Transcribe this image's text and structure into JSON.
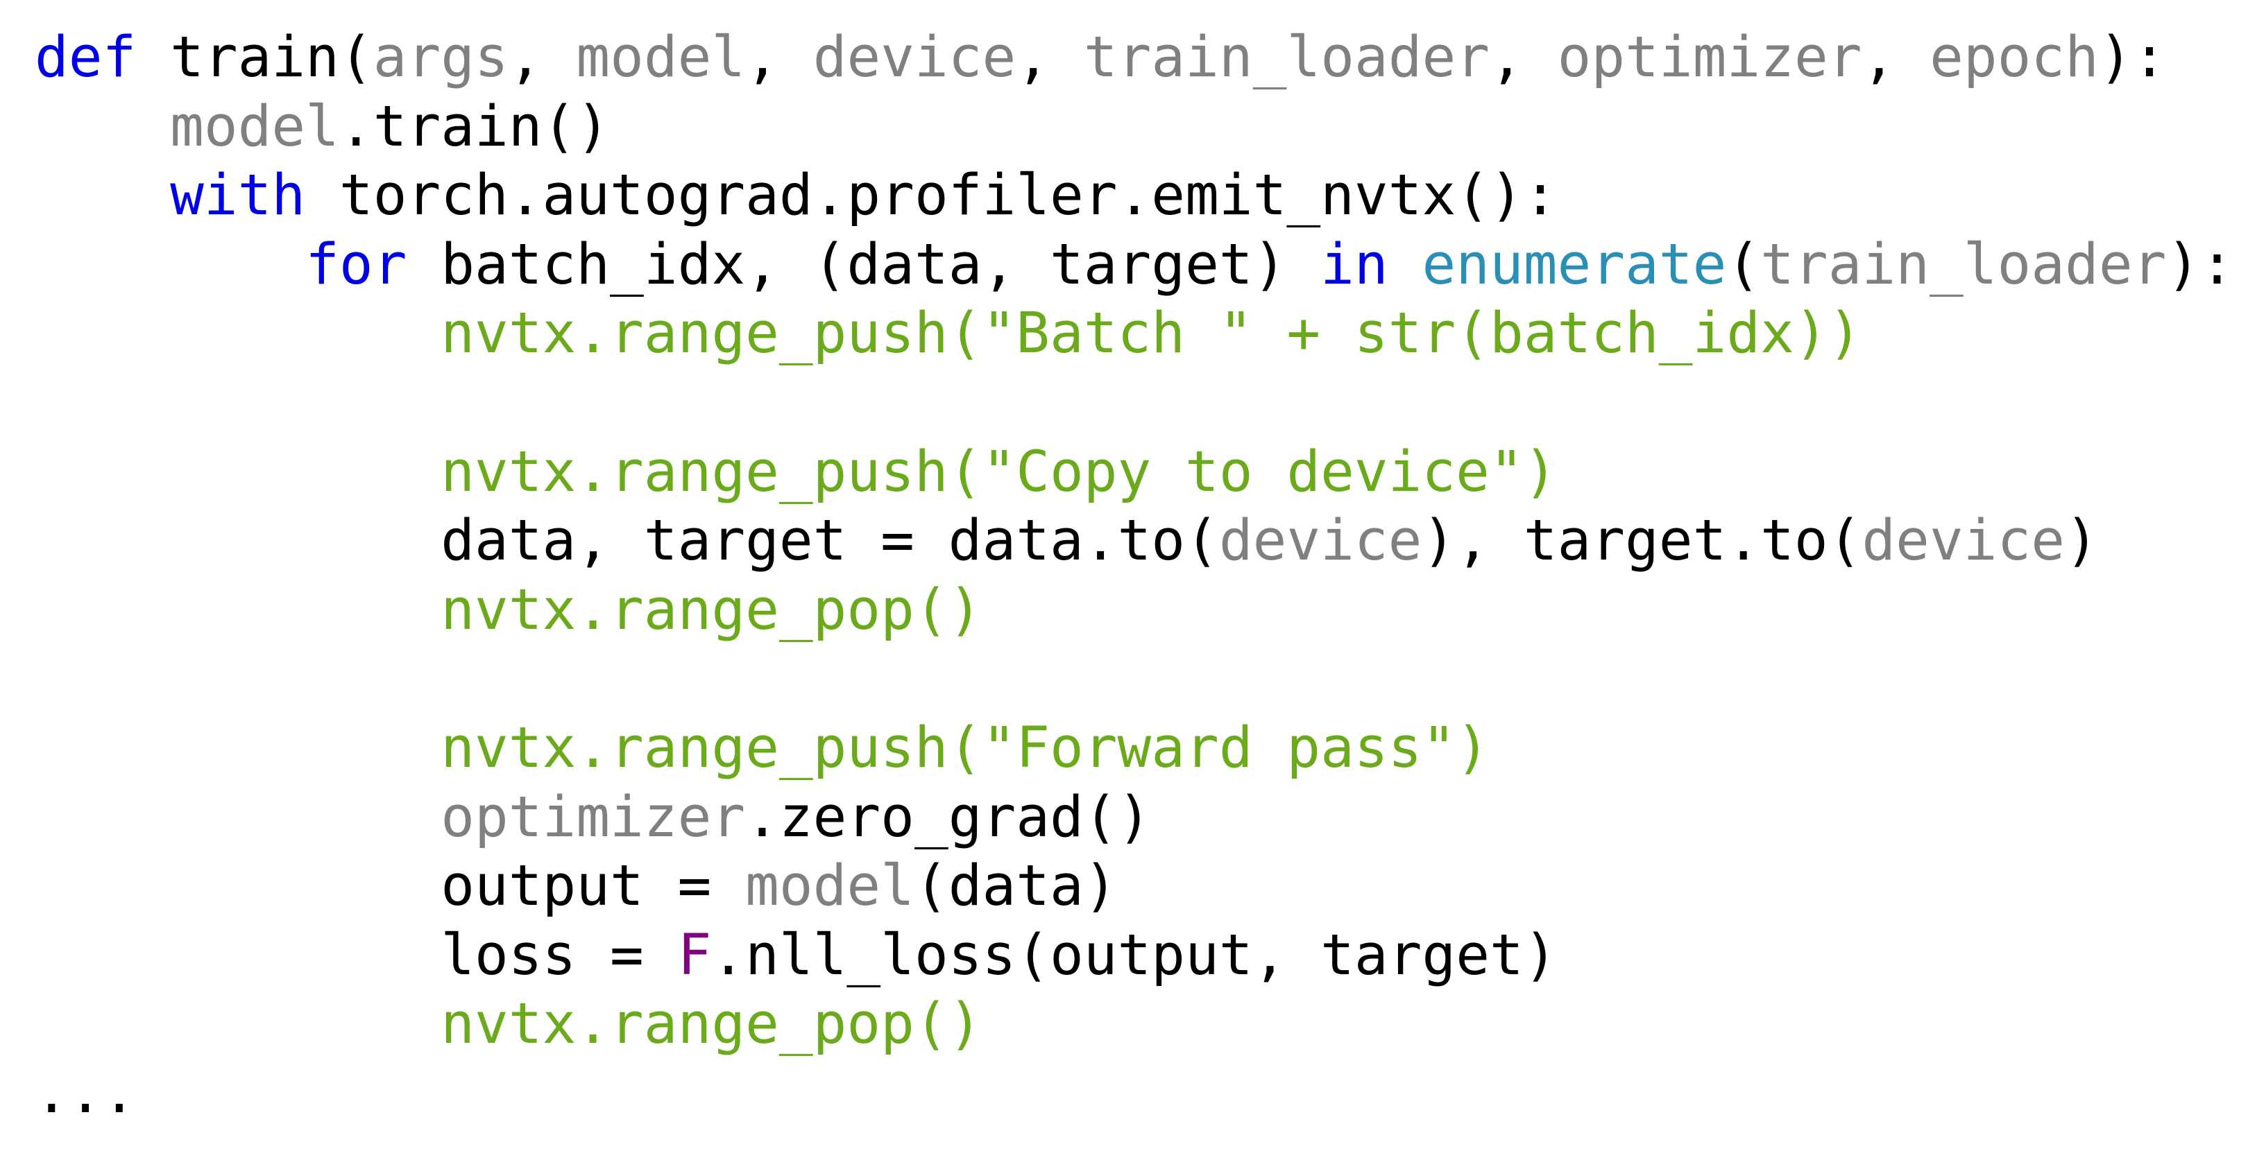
{
  "colors": {
    "keyword": "#0000e6",
    "param": "#808080",
    "builtin": "#2b8fb5",
    "nvtx": "#6aaa1b",
    "class": "#800080",
    "plain": "#000000",
    "background": "#ffffff"
  },
  "code_lines": [
    [
      {
        "t": "def",
        "k": "kw"
      },
      {
        "t": " train(",
        "k": "plain"
      },
      {
        "t": "args",
        "k": "param"
      },
      {
        "t": ", ",
        "k": "plain"
      },
      {
        "t": "model",
        "k": "param"
      },
      {
        "t": ", ",
        "k": "plain"
      },
      {
        "t": "device",
        "k": "param"
      },
      {
        "t": ", ",
        "k": "plain"
      },
      {
        "t": "train_loader",
        "k": "param"
      },
      {
        "t": ", ",
        "k": "plain"
      },
      {
        "t": "optimizer",
        "k": "param"
      },
      {
        "t": ", ",
        "k": "plain"
      },
      {
        "t": "epoch",
        "k": "param"
      },
      {
        "t": "):",
        "k": "plain"
      }
    ],
    [
      {
        "t": "    ",
        "k": "plain"
      },
      {
        "t": "model",
        "k": "param"
      },
      {
        "t": ".train()",
        "k": "plain"
      }
    ],
    [
      {
        "t": "    ",
        "k": "plain"
      },
      {
        "t": "with",
        "k": "kw"
      },
      {
        "t": " torch.autograd.profiler.emit_nvtx():",
        "k": "plain"
      }
    ],
    [
      {
        "t": "        ",
        "k": "plain"
      },
      {
        "t": "for",
        "k": "kw"
      },
      {
        "t": " batch_idx, (data, target) ",
        "k": "plain"
      },
      {
        "t": "in",
        "k": "kw"
      },
      {
        "t": " ",
        "k": "plain"
      },
      {
        "t": "enumerate",
        "k": "builtin"
      },
      {
        "t": "(",
        "k": "plain"
      },
      {
        "t": "train_loader",
        "k": "param"
      },
      {
        "t": "):",
        "k": "plain"
      }
    ],
    [
      {
        "t": "            ",
        "k": "plain"
      },
      {
        "t": "nvtx.range_push(\"Batch \" + str(batch_idx))",
        "k": "nvtx"
      }
    ],
    [],
    [
      {
        "t": "            ",
        "k": "plain"
      },
      {
        "t": "nvtx.range_push(\"Copy to device\")",
        "k": "nvtx"
      }
    ],
    [
      {
        "t": "            data, target = data.to(",
        "k": "plain"
      },
      {
        "t": "device",
        "k": "param"
      },
      {
        "t": "), target.to(",
        "k": "plain"
      },
      {
        "t": "device",
        "k": "param"
      },
      {
        "t": ")",
        "k": "plain"
      }
    ],
    [
      {
        "t": "            ",
        "k": "plain"
      },
      {
        "t": "nvtx.range_pop()",
        "k": "nvtx"
      }
    ],
    [],
    [
      {
        "t": "            ",
        "k": "plain"
      },
      {
        "t": "nvtx.range_push(\"Forward pass\")",
        "k": "nvtx"
      }
    ],
    [
      {
        "t": "            ",
        "k": "plain"
      },
      {
        "t": "optimizer",
        "k": "param"
      },
      {
        "t": ".zero_grad()",
        "k": "plain"
      }
    ],
    [
      {
        "t": "            output = ",
        "k": "plain"
      },
      {
        "t": "model",
        "k": "param"
      },
      {
        "t": "(data)",
        "k": "plain"
      }
    ],
    [
      {
        "t": "            loss = ",
        "k": "plain"
      },
      {
        "t": "F",
        "k": "class"
      },
      {
        "t": ".nll_loss(output, target)",
        "k": "plain"
      }
    ],
    [
      {
        "t": "            ",
        "k": "plain"
      },
      {
        "t": "nvtx.range_pop()",
        "k": "nvtx"
      }
    ],
    [
      {
        "t": "...",
        "k": "plain"
      }
    ]
  ]
}
